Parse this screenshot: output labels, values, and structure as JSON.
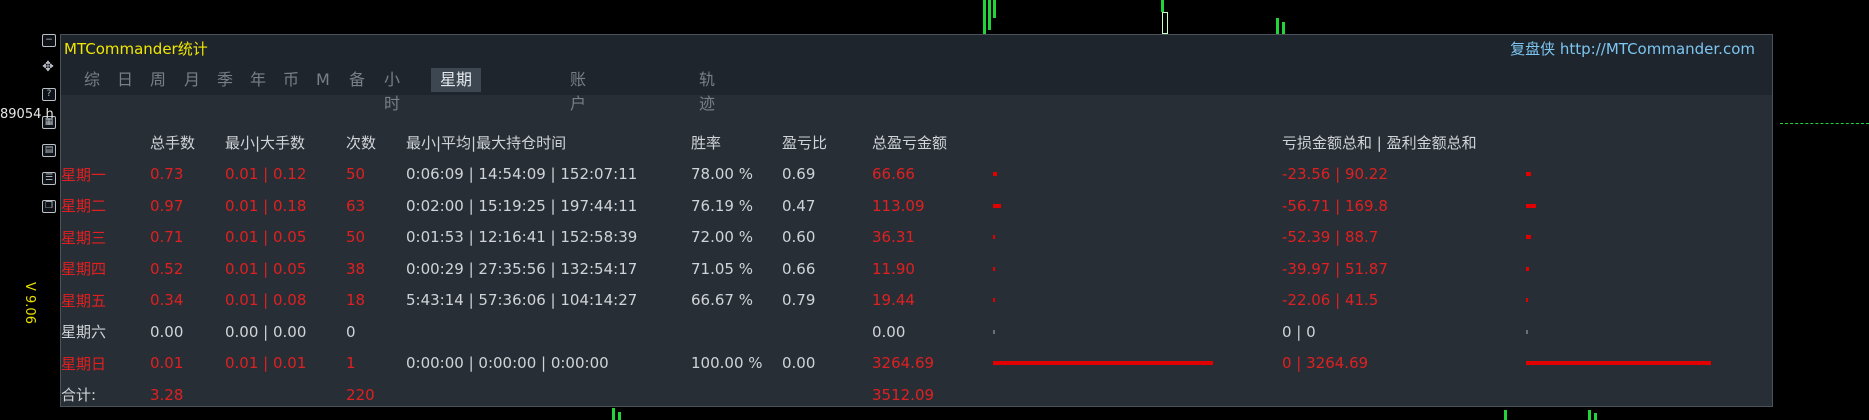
{
  "window": {
    "title": "MTCommander统计",
    "header_link": "复盘侠 http://MTCommander.com"
  },
  "edge": {
    "left_text": "89054 h",
    "version": "V 9.06"
  },
  "tabs": [
    "综",
    "日",
    "周",
    "月",
    "季",
    "年",
    "币",
    "M",
    "备",
    "小时",
    "星期",
    "账户",
    "轨迹"
  ],
  "active_tab": "星期",
  "table": {
    "columns": [
      "",
      "总手数",
      "最小|大手数",
      "次数",
      "最小|平均|最大持仓时间",
      "胜率",
      "盈亏比",
      "总盈亏金额",
      "",
      "亏损金额总和 | 盈利金额总和",
      ""
    ],
    "rows": [
      {
        "day": "星期一",
        "lots": "0.73",
        "minmax": "0.01 | 0.12",
        "count": "50",
        "hold": "0:06:09 | 14:54:09 | 152:07:11",
        "win": "78.00 %",
        "pl": "0.69",
        "total": "66.66",
        "losswin": "-23.56 | 90.22",
        "total_frac": 0.02,
        "loss_frac": 0.006,
        "win_frac": 0.025,
        "style": "red"
      },
      {
        "day": "星期二",
        "lots": "0.97",
        "minmax": "0.01 | 0.18",
        "count": "63",
        "hold": "0:02:00 | 15:19:25 | 197:44:11",
        "win": "76.19 %",
        "pl": "0.47",
        "total": "113.09",
        "losswin": "-56.71 | 169.8",
        "total_frac": 0.035,
        "loss_frac": 0.015,
        "win_frac": 0.046,
        "style": "red"
      },
      {
        "day": "星期三",
        "lots": "0.71",
        "minmax": "0.01 | 0.05",
        "count": "50",
        "hold": "0:01:53 | 12:16:41 | 152:58:39",
        "win": "72.00 %",
        "pl": "0.60",
        "total": "36.31",
        "losswin": "-52.39 | 88.7",
        "total_frac": 0.011,
        "loss_frac": 0.014,
        "win_frac": 0.024,
        "style": "red"
      },
      {
        "day": "星期四",
        "lots": "0.52",
        "minmax": "0.01 | 0.05",
        "count": "38",
        "hold": "0:00:29 | 27:35:56 | 132:54:17",
        "win": "71.05 %",
        "pl": "0.66",
        "total": "11.90",
        "losswin": "-39.97 | 51.87",
        "total_frac": 0.004,
        "loss_frac": 0.011,
        "win_frac": 0.014,
        "style": "red"
      },
      {
        "day": "星期五",
        "lots": "0.34",
        "minmax": "0.01 | 0.08",
        "count": "18",
        "hold": "5:43:14 | 57:36:06 | 104:14:27",
        "win": "66.67 %",
        "pl": "0.79",
        "total": "19.44",
        "losswin": "-22.06 | 41.5",
        "total_frac": 0.006,
        "loss_frac": 0.006,
        "win_frac": 0.011,
        "style": "red"
      },
      {
        "day": "星期六",
        "lots": "0.00",
        "minmax": "0.00 | 0.00",
        "count": "0",
        "hold": "",
        "win": "",
        "pl": "",
        "total": "0.00",
        "losswin": "0 | 0",
        "total_frac": 0,
        "loss_frac": 0,
        "win_frac": 0,
        "style": "plain"
      },
      {
        "day": "星期日",
        "lots": "0.01",
        "minmax": "0.01 | 0.01",
        "count": "1",
        "hold": "0:00:00 | 0:00:00 | 0:00:00",
        "win": "100.00 %",
        "pl": "0.00",
        "total": "3264.69",
        "losswin": "0 | 3264.69",
        "total_frac": 1.0,
        "loss_frac": 0,
        "win_frac": 0.88,
        "style": "red"
      }
    ],
    "footer": {
      "label": "合计:",
      "lots": "3.28",
      "count": "220",
      "total": "3512.09"
    }
  },
  "colors": {
    "loss_red": "#e02020",
    "title_yellow": "#f0e800",
    "link_blue": "#7cc6f2",
    "panel_bg": "#272e36"
  }
}
